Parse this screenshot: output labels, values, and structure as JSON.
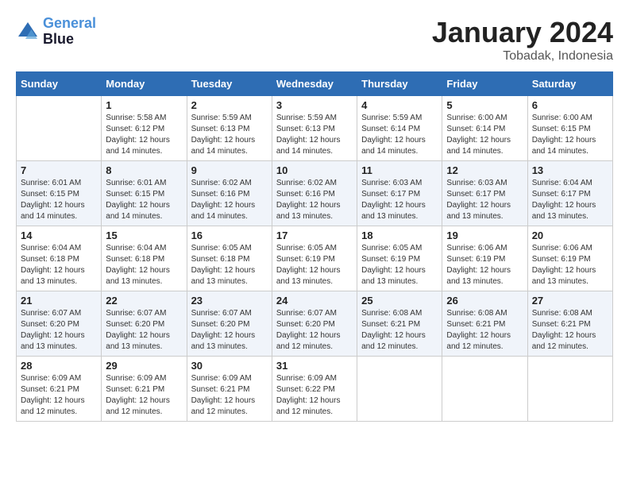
{
  "header": {
    "logo_line1": "General",
    "logo_line2": "Blue",
    "month": "January 2024",
    "location": "Tobadak, Indonesia"
  },
  "weekdays": [
    "Sunday",
    "Monday",
    "Tuesday",
    "Wednesday",
    "Thursday",
    "Friday",
    "Saturday"
  ],
  "weeks": [
    [
      {
        "day": "",
        "sunrise": "",
        "sunset": "",
        "daylight": ""
      },
      {
        "day": "1",
        "sunrise": "Sunrise: 5:58 AM",
        "sunset": "Sunset: 6:12 PM",
        "daylight": "Daylight: 12 hours and 14 minutes."
      },
      {
        "day": "2",
        "sunrise": "Sunrise: 5:59 AM",
        "sunset": "Sunset: 6:13 PM",
        "daylight": "Daylight: 12 hours and 14 minutes."
      },
      {
        "day": "3",
        "sunrise": "Sunrise: 5:59 AM",
        "sunset": "Sunset: 6:13 PM",
        "daylight": "Daylight: 12 hours and 14 minutes."
      },
      {
        "day": "4",
        "sunrise": "Sunrise: 5:59 AM",
        "sunset": "Sunset: 6:14 PM",
        "daylight": "Daylight: 12 hours and 14 minutes."
      },
      {
        "day": "5",
        "sunrise": "Sunrise: 6:00 AM",
        "sunset": "Sunset: 6:14 PM",
        "daylight": "Daylight: 12 hours and 14 minutes."
      },
      {
        "day": "6",
        "sunrise": "Sunrise: 6:00 AM",
        "sunset": "Sunset: 6:15 PM",
        "daylight": "Daylight: 12 hours and 14 minutes."
      }
    ],
    [
      {
        "day": "7",
        "sunrise": "Sunrise: 6:01 AM",
        "sunset": "Sunset: 6:15 PM",
        "daylight": "Daylight: 12 hours and 14 minutes."
      },
      {
        "day": "8",
        "sunrise": "Sunrise: 6:01 AM",
        "sunset": "Sunset: 6:15 PM",
        "daylight": "Daylight: 12 hours and 14 minutes."
      },
      {
        "day": "9",
        "sunrise": "Sunrise: 6:02 AM",
        "sunset": "Sunset: 6:16 PM",
        "daylight": "Daylight: 12 hours and 14 minutes."
      },
      {
        "day": "10",
        "sunrise": "Sunrise: 6:02 AM",
        "sunset": "Sunset: 6:16 PM",
        "daylight": "Daylight: 12 hours and 13 minutes."
      },
      {
        "day": "11",
        "sunrise": "Sunrise: 6:03 AM",
        "sunset": "Sunset: 6:17 PM",
        "daylight": "Daylight: 12 hours and 13 minutes."
      },
      {
        "day": "12",
        "sunrise": "Sunrise: 6:03 AM",
        "sunset": "Sunset: 6:17 PM",
        "daylight": "Daylight: 12 hours and 13 minutes."
      },
      {
        "day": "13",
        "sunrise": "Sunrise: 6:04 AM",
        "sunset": "Sunset: 6:17 PM",
        "daylight": "Daylight: 12 hours and 13 minutes."
      }
    ],
    [
      {
        "day": "14",
        "sunrise": "Sunrise: 6:04 AM",
        "sunset": "Sunset: 6:18 PM",
        "daylight": "Daylight: 12 hours and 13 minutes."
      },
      {
        "day": "15",
        "sunrise": "Sunrise: 6:04 AM",
        "sunset": "Sunset: 6:18 PM",
        "daylight": "Daylight: 12 hours and 13 minutes."
      },
      {
        "day": "16",
        "sunrise": "Sunrise: 6:05 AM",
        "sunset": "Sunset: 6:18 PM",
        "daylight": "Daylight: 12 hours and 13 minutes."
      },
      {
        "day": "17",
        "sunrise": "Sunrise: 6:05 AM",
        "sunset": "Sunset: 6:19 PM",
        "daylight": "Daylight: 12 hours and 13 minutes."
      },
      {
        "day": "18",
        "sunrise": "Sunrise: 6:05 AM",
        "sunset": "Sunset: 6:19 PM",
        "daylight": "Daylight: 12 hours and 13 minutes."
      },
      {
        "day": "19",
        "sunrise": "Sunrise: 6:06 AM",
        "sunset": "Sunset: 6:19 PM",
        "daylight": "Daylight: 12 hours and 13 minutes."
      },
      {
        "day": "20",
        "sunrise": "Sunrise: 6:06 AM",
        "sunset": "Sunset: 6:19 PM",
        "daylight": "Daylight: 12 hours and 13 minutes."
      }
    ],
    [
      {
        "day": "21",
        "sunrise": "Sunrise: 6:07 AM",
        "sunset": "Sunset: 6:20 PM",
        "daylight": "Daylight: 12 hours and 13 minutes."
      },
      {
        "day": "22",
        "sunrise": "Sunrise: 6:07 AM",
        "sunset": "Sunset: 6:20 PM",
        "daylight": "Daylight: 12 hours and 13 minutes."
      },
      {
        "day": "23",
        "sunrise": "Sunrise: 6:07 AM",
        "sunset": "Sunset: 6:20 PM",
        "daylight": "Daylight: 12 hours and 13 minutes."
      },
      {
        "day": "24",
        "sunrise": "Sunrise: 6:07 AM",
        "sunset": "Sunset: 6:20 PM",
        "daylight": "Daylight: 12 hours and 12 minutes."
      },
      {
        "day": "25",
        "sunrise": "Sunrise: 6:08 AM",
        "sunset": "Sunset: 6:21 PM",
        "daylight": "Daylight: 12 hours and 12 minutes."
      },
      {
        "day": "26",
        "sunrise": "Sunrise: 6:08 AM",
        "sunset": "Sunset: 6:21 PM",
        "daylight": "Daylight: 12 hours and 12 minutes."
      },
      {
        "day": "27",
        "sunrise": "Sunrise: 6:08 AM",
        "sunset": "Sunset: 6:21 PM",
        "daylight": "Daylight: 12 hours and 12 minutes."
      }
    ],
    [
      {
        "day": "28",
        "sunrise": "Sunrise: 6:09 AM",
        "sunset": "Sunset: 6:21 PM",
        "daylight": "Daylight: 12 hours and 12 minutes."
      },
      {
        "day": "29",
        "sunrise": "Sunrise: 6:09 AM",
        "sunset": "Sunset: 6:21 PM",
        "daylight": "Daylight: 12 hours and 12 minutes."
      },
      {
        "day": "30",
        "sunrise": "Sunrise: 6:09 AM",
        "sunset": "Sunset: 6:21 PM",
        "daylight": "Daylight: 12 hours and 12 minutes."
      },
      {
        "day": "31",
        "sunrise": "Sunrise: 6:09 AM",
        "sunset": "Sunset: 6:22 PM",
        "daylight": "Daylight: 12 hours and 12 minutes."
      },
      {
        "day": "",
        "sunrise": "",
        "sunset": "",
        "daylight": ""
      },
      {
        "day": "",
        "sunrise": "",
        "sunset": "",
        "daylight": ""
      },
      {
        "day": "",
        "sunrise": "",
        "sunset": "",
        "daylight": ""
      }
    ]
  ]
}
